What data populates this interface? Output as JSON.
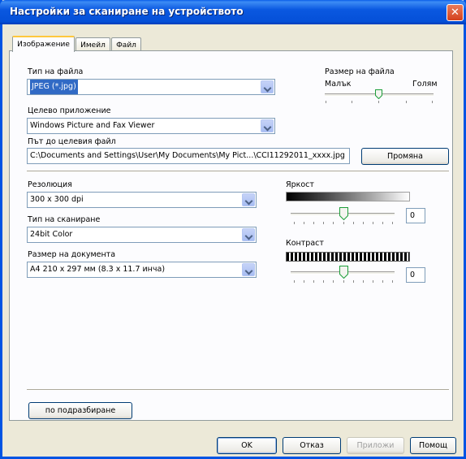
{
  "window": {
    "title": "Настройки за сканиране на устройството",
    "close_symbol": "✕"
  },
  "tabs": [
    {
      "label": "Изображение"
    },
    {
      "label": "Имейл"
    },
    {
      "label": "Файл"
    }
  ],
  "file_type": {
    "label": "Тип на файла",
    "value": "JPEG (*.jpg)"
  },
  "file_size": {
    "label": "Размер на файла",
    "min_label": "Малък",
    "max_label": "Голям",
    "level": 0.5
  },
  "target_app": {
    "label": "Целево приложение",
    "value": "Windows Picture and Fax Viewer"
  },
  "target_path": {
    "label": "Път до целевия файл",
    "value": "C:\\Documents and Settings\\User\\My Documents\\My Pict...\\CCI11292011_xxxx.jpg",
    "change_button": "Промяна"
  },
  "resolution": {
    "label": "Резолюция",
    "value": "300 x 300 dpi"
  },
  "scan_type": {
    "label": "Тип на сканиране",
    "value": "24bit Color"
  },
  "document_size": {
    "label": "Размер на документа",
    "value": "A4 210 x 297 мм (8.3 x 11.7 инча)"
  },
  "brightness": {
    "label": "Яркост",
    "value": "0",
    "level": 0.5
  },
  "contrast": {
    "label": "Контраст",
    "value": "0",
    "level": 0.5
  },
  "default_button": "по подразбиране",
  "footer": {
    "ok": "OK",
    "cancel": "Отказ",
    "apply": "Приложи",
    "help": "Помощ"
  }
}
